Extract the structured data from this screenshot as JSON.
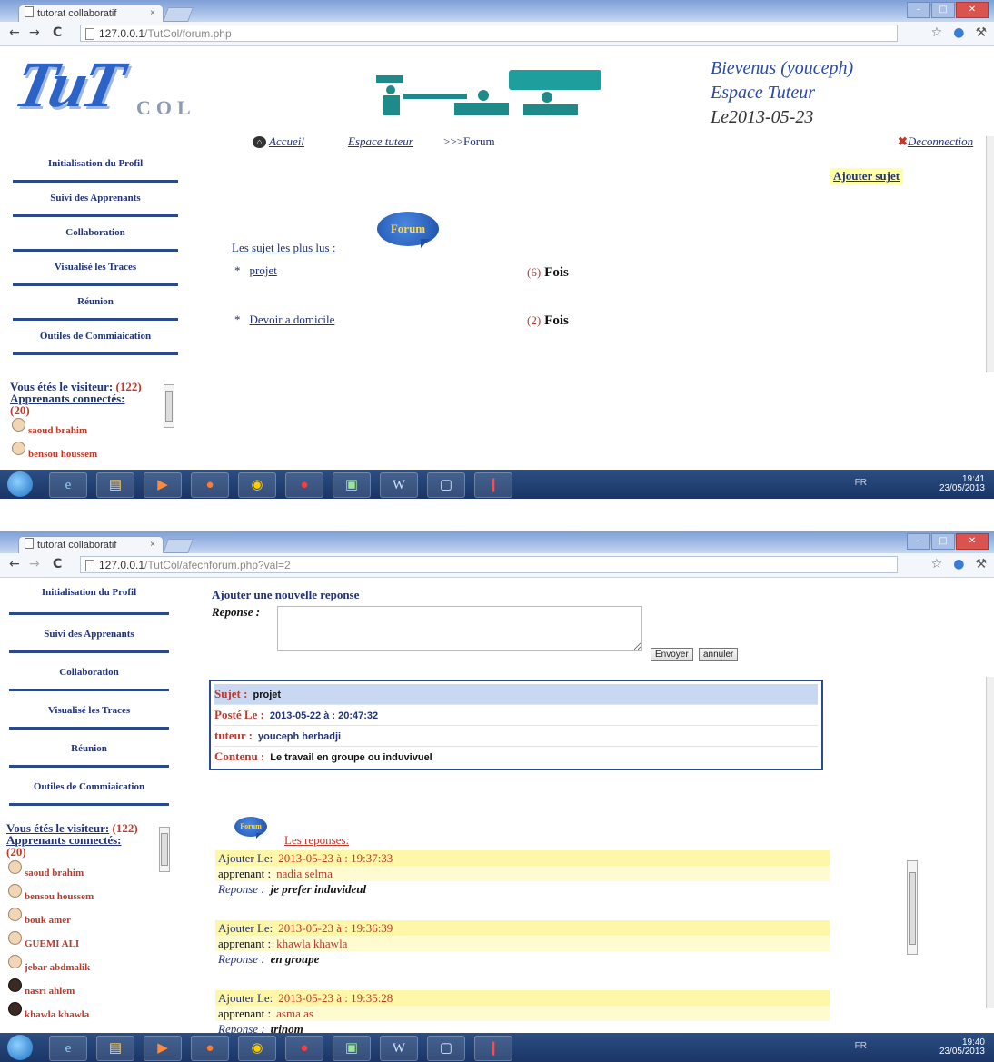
{
  "screen1": {
    "browser": {
      "tab_title": "tutorat collaboratif",
      "tab_close": "×",
      "url_host": "127.0.0.1",
      "url_path": "/TutCol/forum.php",
      "back_icon": "←",
      "forward_icon": "→",
      "reload_icon": "C",
      "window_min": "–",
      "window_max": "□",
      "window_close": "✕",
      "star_icon": "☆",
      "wrench_icon": "⚒"
    },
    "banner": {
      "logo_text": "TuT",
      "logo_sub": "COL",
      "welcome": "Bievenus (youceph)",
      "space": "Espace Tuteur",
      "date": "Le2013-05-23"
    },
    "nav": {
      "home_icon": "⌂",
      "home": "Accueil",
      "space": "Espace tuteur",
      "crumb": ">>>Forum",
      "logout_icon": "✖",
      "logout": "Deconnection"
    },
    "sidebar": {
      "items": [
        "Initialisation du Profil",
        "Suivi des Apprenants",
        "Collaboration",
        "Visualisé les Traces",
        "Réunion",
        "Outiles de Commiaication"
      ],
      "visitor_label": "Vous étés le visiteur:",
      "visitor_count": "(122)",
      "connected_label": "Apprenants connectés:",
      "connected_count": "(20)",
      "users": [
        "saoud brahim",
        "bensou houssem"
      ]
    },
    "content": {
      "add_subject": "Ajouter sujet",
      "forum_badge": "Forum",
      "popular_title": "Les sujet les plus lus :",
      "bullet": "*",
      "fois": "Fois",
      "popular": [
        {
          "subject": "projet",
          "count": "(6)"
        },
        {
          "subject": "Devoir a domicile",
          "count": "(2)"
        }
      ]
    },
    "taskbar": {
      "icons": [
        "e",
        "▤",
        "▶",
        "●",
        "◉",
        "●",
        "▣",
        "W",
        "▢",
        "❙"
      ],
      "lang": "FR",
      "time": "19:41",
      "date": "23/05/2013"
    }
  },
  "screen2": {
    "browser": {
      "tab_title": "tutorat collaboratif",
      "tab_close": "×",
      "url_host": "127.0.0.1",
      "url_path": "/TutCol/afechforum.php?val=2",
      "back_icon": "←",
      "forward_icon": "→",
      "reload_icon": "C",
      "window_min": "–",
      "window_max": "□",
      "window_close": "✕",
      "star_icon": "☆",
      "wrench_icon": "⚒"
    },
    "sidebar": {
      "items": [
        "Initialisation du Profil",
        "Suivi des Apprenants",
        "Collaboration",
        "Visualisé les Traces",
        "Réunion",
        "Outiles de Commiaication"
      ],
      "visitor_label": "Vous étés le visiteur:",
      "visitor_count": "(122)",
      "connected_label": "Apprenants connectés:",
      "connected_count": "(20)",
      "users": [
        "saoud brahim",
        "bensou houssem",
        "bouk amer",
        "GUEMI ALI",
        "jebar abdmalik",
        "nasri ahlem",
        "khawla khawla"
      ]
    },
    "reply_form": {
      "heading": "Ajouter une nouvelle reponse",
      "label": "Reponse :",
      "value": "",
      "send": "Envoyer",
      "cancel": "annuler"
    },
    "subject": {
      "subject_label": "Sujet :",
      "subject_value": "projet",
      "posted_label": "Posté Le :",
      "posted_value": "2013-05-22 à : 20:47:32",
      "tutor_label": "tuteur :",
      "tutor_value": "youceph herbadji",
      "content_label": "Contenu :",
      "content_value": "Le travail en groupe ou induvivuel"
    },
    "replies": {
      "forum_badge": "Forum",
      "title": "Les reponses:",
      "added_label": "Ajouter Le:",
      "learner_label": "apprenant :",
      "reply_label": "Reponse :",
      "items": [
        {
          "date": "2013-05-23 à : 19:37:33",
          "learner": "nadia selma",
          "text": "je prefer induvideul"
        },
        {
          "date": "2013-05-23 à : 19:36:39",
          "learner": "khawla khawla",
          "text": "en groupe"
        },
        {
          "date": "2013-05-23 à : 19:35:28",
          "learner": "asma as",
          "text": "trinom"
        }
      ]
    },
    "taskbar": {
      "icons": [
        "e",
        "▤",
        "▶",
        "●",
        "◉",
        "●",
        "▣",
        "W",
        "▢",
        "❙"
      ],
      "lang": "FR",
      "time": "19:40",
      "date": "23/05/2013"
    }
  }
}
